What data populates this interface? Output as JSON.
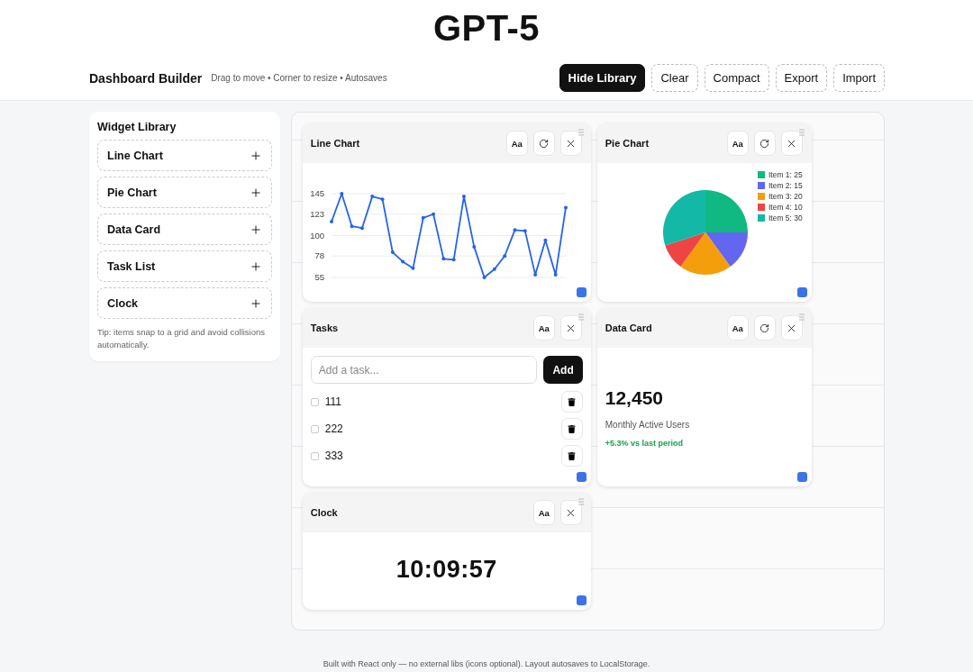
{
  "page_title": "GPT-5",
  "header": {
    "title": "Dashboard Builder",
    "hint": "Drag to move • Corner to resize • Autosaves",
    "buttons": [
      {
        "label": "Hide Library",
        "primary": true
      },
      {
        "label": "Clear",
        "primary": false
      },
      {
        "label": "Compact",
        "primary": false
      },
      {
        "label": "Export",
        "primary": false
      },
      {
        "label": "Import",
        "primary": false
      }
    ]
  },
  "library": {
    "title": "Widget Library",
    "items": [
      "Line Chart",
      "Pie Chart",
      "Data Card",
      "Task List",
      "Clock"
    ],
    "tip": "Tip: items snap to a grid and avoid collisions automatically."
  },
  "widgets": [
    {
      "kind": "line",
      "title": "Line Chart",
      "font_button": "Aa",
      "refresh": true,
      "chart_data": {
        "type": "line",
        "ylim": [
          55,
          145
        ],
        "grid": true,
        "yticks": [
          55,
          78,
          100,
          123,
          145
        ],
        "series": [
          {
            "color": "#2563eb",
            "values": [
              115,
              145,
              110,
              108,
              142,
              139,
              82,
              72,
              65,
              119,
              123,
              75,
              74,
              142,
              88,
              55,
              64,
              78,
              106,
              105,
              58,
              95,
              58,
              130
            ]
          }
        ]
      }
    },
    {
      "kind": "pie",
      "title": "Pie Chart",
      "font_button": "Aa",
      "refresh": true,
      "chart_data": {
        "type": "pie",
        "values": [
          25,
          15,
          20,
          10,
          30
        ]
      },
      "legend": [
        {
          "label": "Item 1: 25",
          "color": "#10b981"
        },
        {
          "label": "Item 2: 15",
          "color": "#6366f1"
        },
        {
          "label": "Item 3: 20",
          "color": "#f59e0b"
        },
        {
          "label": "Item 4: 10",
          "color": "#ef4444"
        },
        {
          "label": "Item 5: 30",
          "color": "#14b8a6"
        }
      ]
    },
    {
      "kind": "tasks",
      "title": "Tasks",
      "font_button": "Aa",
      "refresh": false,
      "placeholder": "Add a task...",
      "add_label": "Add",
      "tasks": [
        {
          "text": "111",
          "checked": false
        },
        {
          "text": "222",
          "checked": false
        },
        {
          "text": "333",
          "checked": false
        }
      ]
    },
    {
      "kind": "stat",
      "title": "Data Card",
      "font_button": "Aa",
      "refresh": true,
      "value": "12,450",
      "label": "Monthly Active Users",
      "change": "+5.3% vs last period"
    },
    {
      "kind": "clock",
      "title": "Clock",
      "font_button": "Aa",
      "refresh": false,
      "time": "10:09:57"
    }
  ],
  "footer": "Built with React only — no external libs (icons optional). Layout autosaves to LocalStorage."
}
